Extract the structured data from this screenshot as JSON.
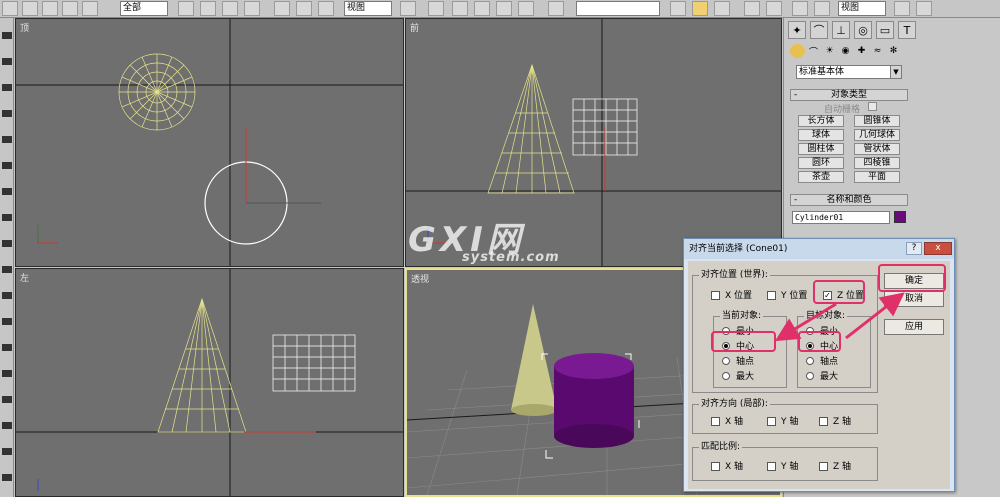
{
  "toolbar": {
    "selection_filter": "全部",
    "ref_coord_system": "视图",
    "ref_coord_system_2": "视图"
  },
  "viewports": {
    "top": "顶",
    "front": "前",
    "left": "左",
    "perspective": "透视"
  },
  "command_panel": {
    "category_dropdown": "标准基本体",
    "object_type_title": "对象类型",
    "autogrid_label": "自动栅格",
    "objects": [
      "长方体",
      "圆锥体",
      "球体",
      "几何球体",
      "圆柱体",
      "管状体",
      "圆环",
      "四棱锥",
      "茶壶",
      "平面"
    ],
    "name_color_title": "名称和颜色",
    "object_name": "Cylinder01",
    "object_color": "#6a0a7a"
  },
  "dialog": {
    "title": "对齐当前选择 (Cone01)",
    "help": "?",
    "close": "x",
    "align_position_group": "对齐位置 (世界):",
    "x_position": "X 位置",
    "y_position": "Y 位置",
    "z_position": "Z 位置",
    "z_checked": "✓",
    "current_object_group": "当前对象:",
    "target_object_group": "目标对象:",
    "options": [
      "最小",
      "中心",
      "轴点",
      "最大"
    ],
    "align_orientation_group": "对齐方向 (局部):",
    "match_scale_group": "匹配比例:",
    "x_axis": "X 轴",
    "y_axis": "Y 轴",
    "z_axis": "Z 轴",
    "ok": "确定",
    "cancel": "取消",
    "apply": "应用"
  },
  "watermark": {
    "main": "GXI网",
    "sub": "system.com"
  },
  "colors": {
    "highlight": "#e0306a",
    "viewport_bg": "#6f6f6f",
    "wireframe": "#e8e48a",
    "cylinder": "#6a0a7a"
  }
}
